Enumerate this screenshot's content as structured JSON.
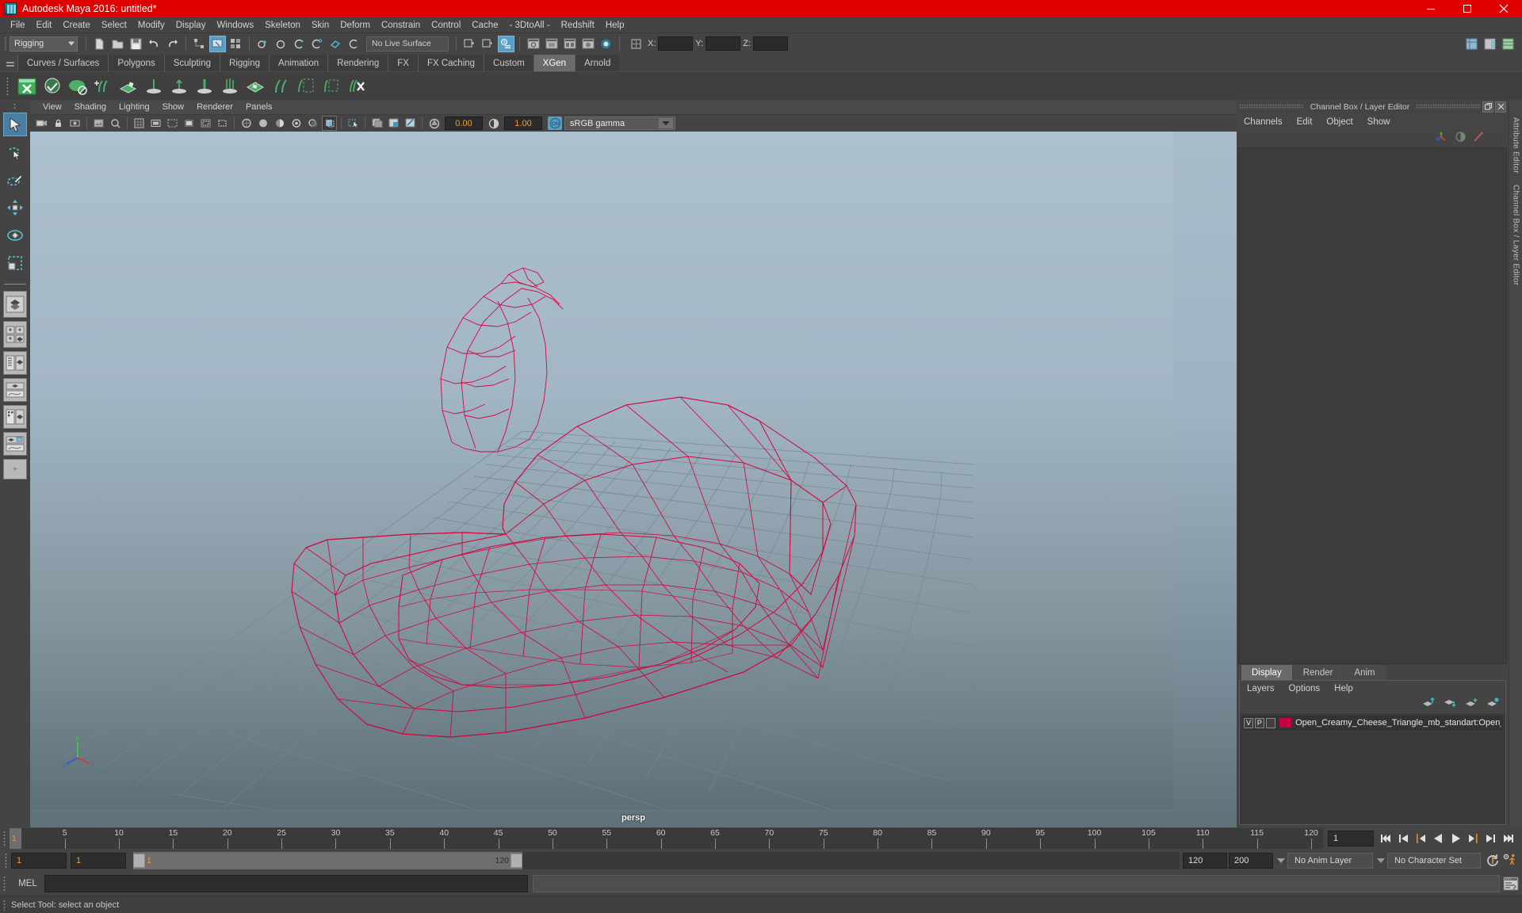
{
  "window": {
    "title": "Autodesk Maya 2016: untitled*",
    "app_icon": "maya-logo-icon",
    "minimize_label": "Minimize",
    "maximize_label": "Restore",
    "close_label": "Close",
    "titlebar_color": "#e00000"
  },
  "menubar": {
    "items": [
      "File",
      "Edit",
      "Create",
      "Select",
      "Modify",
      "Display",
      "Windows",
      "Skeleton",
      "Skin",
      "Deform",
      "Constrain",
      "Control",
      "Cache",
      "- 3DtoAll -",
      "Redshift",
      "Help"
    ]
  },
  "statusline": {
    "mode": "Rigging",
    "live_surface": "No Live Surface",
    "axis_labels": [
      "X:",
      "Y:",
      "Z:"
    ],
    "axis_values": [
      "",
      "",
      ""
    ]
  },
  "shelf": {
    "tabs": [
      {
        "label": "Curves / Surfaces",
        "active": false
      },
      {
        "label": "Polygons",
        "active": false
      },
      {
        "label": "Sculpting",
        "active": false
      },
      {
        "label": "Rigging",
        "active": false
      },
      {
        "label": "Animation",
        "active": false
      },
      {
        "label": "Rendering",
        "active": false
      },
      {
        "label": "FX",
        "active": false
      },
      {
        "label": "FX Caching",
        "active": false
      },
      {
        "label": "Custom",
        "active": false
      },
      {
        "label": "XGen",
        "active": true
      },
      {
        "label": "Arnold",
        "active": false
      }
    ],
    "active_tab": "XGen"
  },
  "toolbox": {
    "items": [
      "select-tool",
      "lasso-select-tool",
      "paint-select-tool",
      "move-tool",
      "rotate-tool",
      "scale-tool"
    ]
  },
  "viewport": {
    "menu": [
      "View",
      "Shading",
      "Lighting",
      "Show",
      "Renderer",
      "Panels"
    ],
    "exposure_value": "0.00",
    "gamma_value": "1.00",
    "color_management_toggle": "ON",
    "color_profile": "sRGB gamma",
    "camera_label": "persp",
    "wireframe_color": "#d4003c",
    "mesh_name": "Open_Creamy_Cheese_Triangle"
  },
  "channelbox": {
    "panel_title": "Channel Box / Layer Editor",
    "menu": [
      "Channels",
      "Edit",
      "Object",
      "Show"
    ],
    "content": ""
  },
  "layers": {
    "tabs": [
      {
        "label": "Display",
        "active": true
      },
      {
        "label": "Render",
        "active": false
      },
      {
        "label": "Anim",
        "active": false
      }
    ],
    "menu": [
      "Layers",
      "Options",
      "Help"
    ],
    "rows": [
      {
        "visibility": "V",
        "playback": "P",
        "color": "#c9003f",
        "name": "Open_Creamy_Cheese_Triangle_mb_standart:Open_Crea"
      }
    ]
  },
  "attribute_editor": {
    "tabs": [
      "Attribute Editor",
      "Channel Box / Layer Editor"
    ]
  },
  "timeslider": {
    "current_frame": "1",
    "cursor_label": "1",
    "ticks": [
      5,
      10,
      15,
      20,
      25,
      30,
      35,
      40,
      45,
      50,
      55,
      60,
      65,
      70,
      75,
      80,
      85,
      90,
      95,
      100,
      105,
      110,
      115,
      120
    ],
    "start": 1,
    "end": 120,
    "playback_buttons": [
      "go-to-start",
      "step-back-key",
      "step-back-frame",
      "play-backwards",
      "play-forwards",
      "step-forward-frame",
      "step-forward-key",
      "go-to-end"
    ]
  },
  "rangeslider": {
    "anim_start": "1",
    "playback_start": "1",
    "range_left_label": "1",
    "range_right_label": "120",
    "playback_end": "120",
    "anim_end": "200",
    "anim_layer": "No Anim Layer",
    "character_set": "No Character Set",
    "auto_keyframe_icon": "auto-keyframe-icon",
    "anim_prefs_icon": "animation-preferences-icon"
  },
  "commandline": {
    "language": "MEL",
    "input_value": "",
    "output_value": "",
    "script_editor_icon": "script-editor-icon"
  },
  "statusbar": {
    "message": "Select Tool: select an object"
  }
}
